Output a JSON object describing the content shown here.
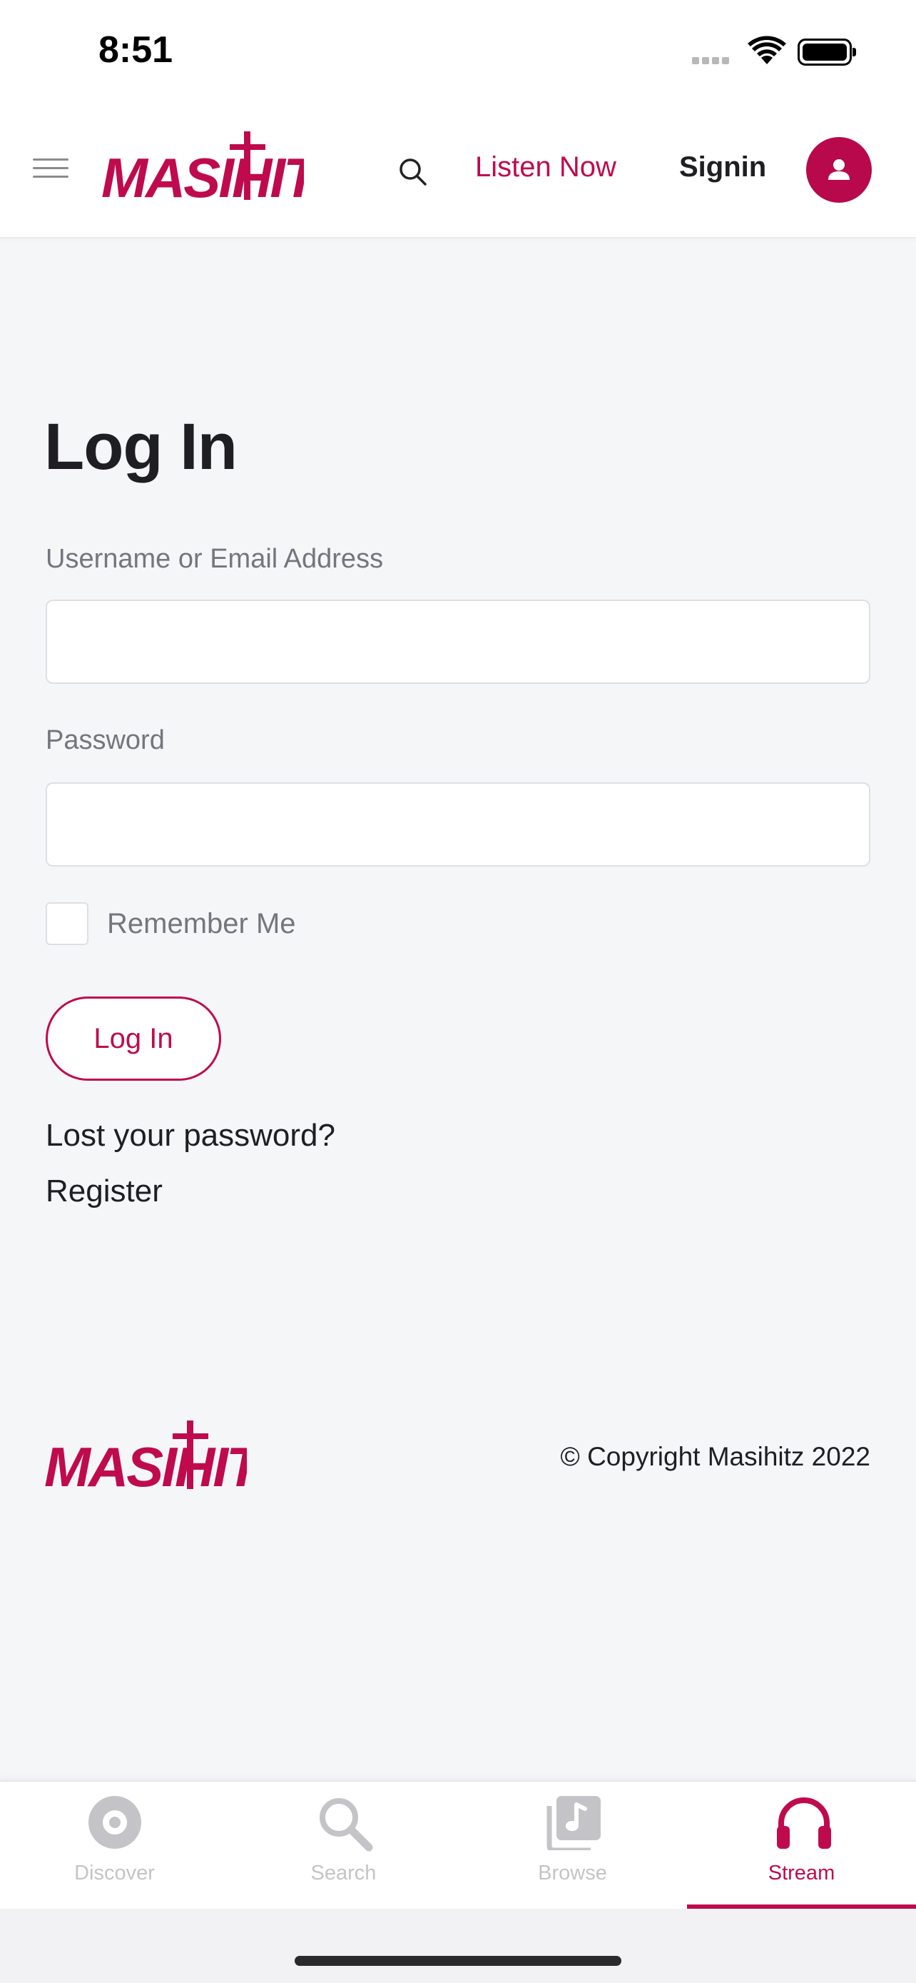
{
  "status_bar": {
    "time": "8:51",
    "icons": [
      "cellular-signal-icon",
      "wifi-icon",
      "battery-icon"
    ]
  },
  "header": {
    "brand": "MASIHITZ",
    "menu_icon": "hamburger-menu-icon",
    "search_icon": "search-icon",
    "listen_now": "Listen Now",
    "signin": "Signin",
    "avatar_icon": "user-icon"
  },
  "login": {
    "title": "Log In",
    "username_label": "Username or Email Address",
    "username_value": "",
    "password_label": "Password",
    "password_value": "",
    "remember_label": "Remember Me",
    "remember_checked": false,
    "button": "Log In",
    "lost_password": "Lost your password?",
    "register": "Register"
  },
  "footer": {
    "brand": "MASIHITZ",
    "copyright": "© Copyright Masihitz 2022"
  },
  "tab_bar": {
    "items": [
      {
        "label": "Discover",
        "icon": "disc-icon",
        "active": false
      },
      {
        "label": "Search",
        "icon": "search-icon",
        "active": false
      },
      {
        "label": "Browse",
        "icon": "music-library-icon",
        "active": false
      },
      {
        "label": "Stream",
        "icon": "headphones-icon",
        "active": true
      }
    ]
  },
  "colors": {
    "accent": "#bf0b4e",
    "background": "#f5f6f8",
    "text_dark": "#1f1f23",
    "text_muted": "#75757d",
    "tab_inactive": "#c4c4c8"
  }
}
